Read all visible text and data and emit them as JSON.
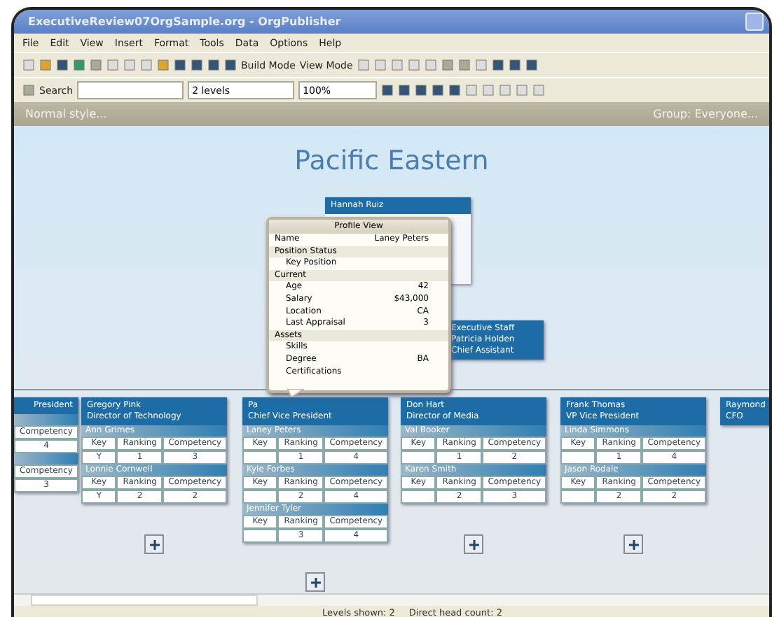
{
  "window": {
    "title": "ExecutiveReview07OrgSample.org - OrgPublisher"
  },
  "menu": [
    "File",
    "Edit",
    "View",
    "Insert",
    "Format",
    "Tools",
    "Data",
    "Options",
    "Help"
  ],
  "toolbar": {
    "build_mode": "Build Mode",
    "view_mode": "View Mode",
    "search": "Search",
    "levels": "2 levels",
    "zoom": "100%"
  },
  "style_bar": {
    "style": "Normal style...",
    "group": "Group: Everyone..."
  },
  "chart_title": "Pacific Eastern",
  "top_node": {
    "name": "Hannah Ruiz"
  },
  "assistant": {
    "name": "Executive Staff",
    "title": "Patricia Holden",
    "subtitle": "Chief Assistant"
  },
  "nodes": [
    {
      "title": "President",
      "expand": false,
      "successors": [
        {
          "headers": [
            "Competency"
          ],
          "competency": "4"
        },
        {
          "headers": [
            "Competency"
          ],
          "competency": "3"
        }
      ]
    },
    {
      "name": "Gregory Pink",
      "title": "Director of Technology",
      "expand": true,
      "successors": [
        {
          "name": "Ann Grimes",
          "headers": [
            "Key",
            "Ranking",
            "Competency"
          ],
          "key": "Y",
          "ranking": "1",
          "competency": "3"
        },
        {
          "name": "Lonnie Cornwell",
          "headers": [
            "Key",
            "Ranking",
            "Competency"
          ],
          "key": "Y",
          "ranking": "2",
          "competency": "2"
        }
      ]
    },
    {
      "name": "Pa",
      "title": "Chief Vice President",
      "expand": true,
      "successors": [
        {
          "name": "Laney Peters",
          "headers": [
            "Key",
            "Ranking",
            "Competency"
          ],
          "ranking": "1",
          "competency": "4"
        },
        {
          "name": "Kyle Forbes",
          "headers": [
            "Key",
            "Ranking",
            "Competency"
          ],
          "ranking": "2",
          "competency": "4"
        },
        {
          "name": "Jennifer Tyler",
          "headers": [
            "Key",
            "Ranking",
            "Competency"
          ],
          "ranking": "3",
          "competency": "4"
        }
      ]
    },
    {
      "name": "Don Hart",
      "title": "Director of Media",
      "expand": true,
      "successors": [
        {
          "name": "Val Booker",
          "headers": [
            "Key",
            "Ranking",
            "Competency"
          ],
          "ranking": "1",
          "competency": "2"
        },
        {
          "name": "Karen Smith",
          "headers": [
            "Key",
            "Ranking",
            "Competency"
          ],
          "ranking": "2",
          "competency": "3"
        }
      ]
    },
    {
      "name": "Frank Thomas",
      "title": "VP Vice President",
      "expand": true,
      "successors": [
        {
          "name": "Linda Simmons",
          "headers": [
            "Key",
            "Ranking",
            "Competency"
          ],
          "ranking": "1",
          "competency": "4"
        },
        {
          "name": "Jason Rodale",
          "headers": [
            "Key",
            "Ranking",
            "Competency"
          ],
          "ranking": "2",
          "competency": "2"
        }
      ]
    },
    {
      "name": "Raymond",
      "title": "CFO",
      "expand": false
    }
  ],
  "profile": {
    "title": "Profile View",
    "rows": [
      {
        "kind": "field",
        "label": "Name",
        "value": "Laney Peters"
      },
      {
        "kind": "section",
        "label": "Position Status"
      },
      {
        "kind": "sub",
        "label": "Key Position"
      },
      {
        "kind": "section",
        "label": "Current"
      },
      {
        "kind": "sub",
        "label": "Age",
        "value": "42"
      },
      {
        "kind": "sub",
        "label": "Salary",
        "value": "$43,000"
      },
      {
        "kind": "sub",
        "label": "Location",
        "value": "CA"
      },
      {
        "kind": "sub",
        "label": "Last Appraisal",
        "value": "3"
      },
      {
        "kind": "section",
        "label": "Assets"
      },
      {
        "kind": "sub",
        "label": "Skills"
      },
      {
        "kind": "sub",
        "label": "Degree",
        "value": "BA"
      },
      {
        "kind": "sub",
        "label": "Certifications"
      }
    ]
  },
  "status_bar": [
    "Levels shown: 2",
    "Direct head count: 2"
  ]
}
